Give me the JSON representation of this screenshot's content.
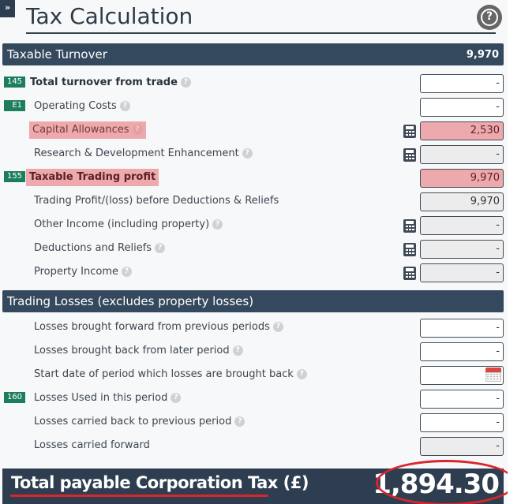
{
  "header": {
    "expander_glyph": "»",
    "title": "Tax Calculation",
    "help_glyph": "?"
  },
  "sections": {
    "turnover": {
      "label": "Taxable Turnover",
      "value": "9,970"
    },
    "losses": {
      "label": "Trading Losses (excludes property losses)"
    }
  },
  "rows": [
    {
      "badge": "145",
      "label": "Total turnover from trade",
      "value": "-"
    },
    {
      "badge": "E1",
      "label": "Operating Costs",
      "value": "-"
    },
    {
      "label": "Capital Allowances",
      "value": "2,530"
    },
    {
      "label": "Research & Development Enhancement",
      "value": "-"
    },
    {
      "badge": "155",
      "label": "Taxable Trading profit",
      "value": "9,970"
    },
    {
      "label": "Trading Profit/(loss) before Deductions & Reliefs",
      "value": "9,970"
    },
    {
      "label": "Other Income (including property)",
      "value": "-"
    },
    {
      "label": "Deductions and Reliefs",
      "value": "-"
    },
    {
      "label": "Property Income",
      "value": "-"
    },
    {
      "label": "Losses brought forward from previous periods",
      "value": "-"
    },
    {
      "label": "Losses brought back from later period",
      "value": "-"
    },
    {
      "label": "Start date of period which losses are brought back",
      "value": ""
    },
    {
      "badge": "160",
      "label": "Losses Used in this period",
      "value": "-"
    },
    {
      "label": "Losses carried back to previous period",
      "value": "-"
    },
    {
      "label": "Losses carried forward",
      "value": "-"
    }
  ],
  "total": {
    "label": "Total payable Corporation Tax (£)",
    "value": "1,894.30"
  },
  "colors": {
    "header_bar": "#34495e",
    "badge": "#1c7e5c",
    "error_highlight": "#eea9ac",
    "annotation_red": "#d9262c"
  }
}
